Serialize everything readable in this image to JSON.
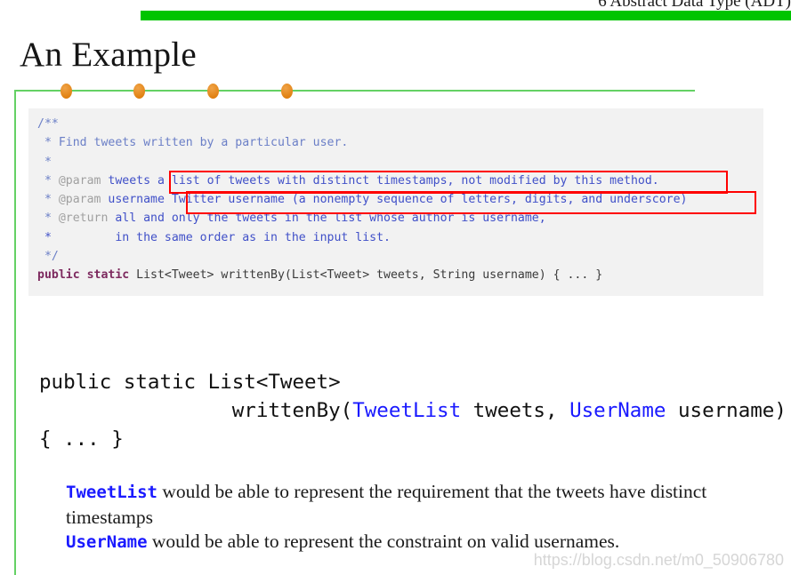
{
  "header": {
    "title": "6 Abstract Data Type (ADT)",
    "bar_color": "#00c400"
  },
  "slide": {
    "title": "An Example",
    "deco_line_color": "#64d164",
    "deco_dot_color": "#e8891c",
    "deco_dot_count": 4
  },
  "code_block": {
    "background": "#f2f2f2",
    "lines": [
      {
        "id": "l1",
        "parts": [
          {
            "text": "/**",
            "style": "comment"
          }
        ]
      },
      {
        "id": "l2",
        "parts": [
          {
            "text": " * Find tweets written by a particular user.",
            "style": "comment"
          }
        ]
      },
      {
        "id": "l3",
        "parts": [
          {
            "text": " *",
            "style": "comment"
          }
        ]
      },
      {
        "id": "l4",
        "parts": [
          {
            "text": " * ",
            "style": "comment"
          },
          {
            "text": "@param",
            "style": "tag"
          },
          {
            "text": " tweets ",
            "style": "text"
          },
          {
            "text": "a list of tweets with distinct timestamps, not modified by this method.",
            "style": "text"
          }
        ]
      },
      {
        "id": "l5",
        "parts": [
          {
            "text": " * ",
            "style": "comment"
          },
          {
            "text": "@param",
            "style": "tag"
          },
          {
            "text": " username ",
            "style": "text"
          },
          {
            "text": "Twitter username (a nonempty sequence of letters, digits, and underscore)",
            "style": "text"
          }
        ]
      },
      {
        "id": "l6",
        "parts": [
          {
            "text": " * ",
            "style": "comment"
          },
          {
            "text": "@return",
            "style": "tag"
          },
          {
            "text": " all and only the tweets in the list whose author is username,",
            "style": "text"
          }
        ]
      },
      {
        "id": "l7",
        "parts": [
          {
            "text": " *         in the same order as in the input list.",
            "style": "text"
          }
        ]
      },
      {
        "id": "l8",
        "parts": [
          {
            "text": " */",
            "style": "comment"
          }
        ]
      },
      {
        "id": "l9",
        "parts": [
          {
            "text": "public static",
            "style": "keyword"
          },
          {
            "text": " List<Tweet> writtenBy(List<Tweet> tweets, String username) { ... }",
            "style": "plain"
          }
        ]
      }
    ],
    "annotations": [
      {
        "id": "red-box-1",
        "label": "param-tweets-highlight",
        "color": "#ff0000"
      },
      {
        "id": "red-box-2",
        "label": "param-username-highlight",
        "color": "#ff0000"
      }
    ]
  },
  "big_code": {
    "line1": "public static List<Tweet>",
    "line2_indent": "                ",
    "line2_a": "writtenBy(",
    "line2_type1": "TweetList",
    "line2_b": " tweets, ",
    "line2_type2": "UserName",
    "line2_c": " username)",
    "line3": "{ ... }",
    "type_color": "#1a1aff"
  },
  "explanation": {
    "para1_term": "TweetList",
    "para1_rest": " would be able to represent the requirement that the tweets have distinct timestamps",
    "para2_term": "UserName",
    "para2_rest": " would be able to represent the constraint on valid usernames.",
    "term_color": "#1a1aff"
  },
  "watermark": {
    "text": "https://blog.csdn.net/m0_50906780"
  }
}
